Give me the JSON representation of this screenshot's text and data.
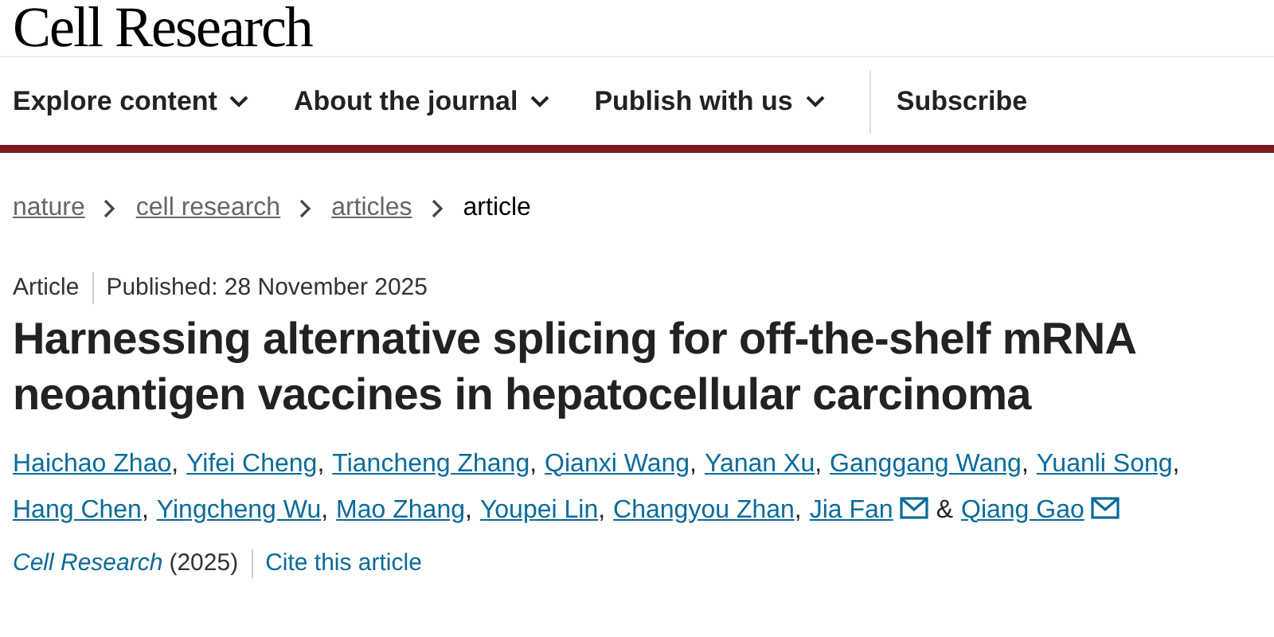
{
  "logo": "Cell Research",
  "nav": [
    {
      "label": "Explore content",
      "kind": "menu"
    },
    {
      "label": "About the journal",
      "kind": "menu"
    },
    {
      "label": "Publish with us",
      "kind": "menu"
    },
    {
      "label": "Subscribe",
      "kind": "link"
    }
  ],
  "breadcrumbs": [
    {
      "label": "nature",
      "kind": "link"
    },
    {
      "label": "cell research",
      "kind": "link"
    },
    {
      "label": "articles",
      "kind": "link"
    },
    {
      "label": "article",
      "kind": "current"
    }
  ],
  "article": {
    "type": "Article",
    "published": "Published: 28 November 2025",
    "title": "Harnessing alternative splicing for off-the-shelf mRNA neoantigen vaccines in hepatocellular carcinoma",
    "authors": [
      {
        "name": "Haichao Zhao",
        "email": false,
        "separator": ","
      },
      {
        "name": "Yifei Cheng",
        "email": false,
        "separator": ","
      },
      {
        "name": "Tiancheng Zhang",
        "email": false,
        "separator": ","
      },
      {
        "name": "Qianxi Wang",
        "email": false,
        "separator": ","
      },
      {
        "name": "Yanan Xu",
        "email": false,
        "separator": ","
      },
      {
        "name": "Ganggang Wang",
        "email": false,
        "separator": ","
      },
      {
        "name": "Yuanli Song",
        "email": false,
        "separator": ","
      },
      {
        "name": "Hang Chen",
        "email": false,
        "separator": ","
      },
      {
        "name": "Yingcheng Wu",
        "email": false,
        "separator": ","
      },
      {
        "name": "Mao Zhang",
        "email": false,
        "separator": ","
      },
      {
        "name": "Youpei Lin",
        "email": false,
        "separator": ","
      },
      {
        "name": "Changyou Zhan",
        "email": false,
        "separator": ","
      },
      {
        "name": "Jia Fan",
        "email": true,
        "separator": "&"
      },
      {
        "name": "Qiang Gao",
        "email": true
      }
    ],
    "journal": "Cell Research",
    "year": "(2025)",
    "cite": "Cite this article"
  }
}
